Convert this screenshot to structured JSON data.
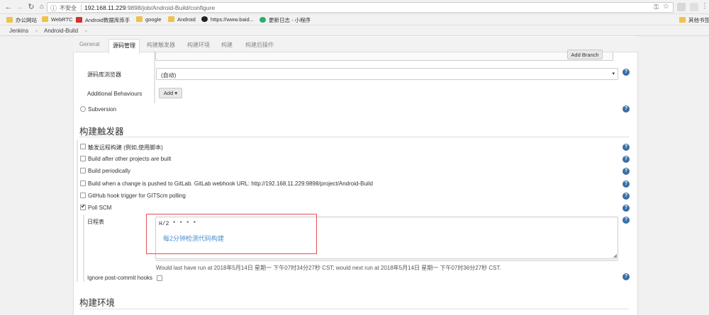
{
  "browser": {
    "insecure_label": "不安全",
    "url_host": "192.168.11.229",
    "url_rest": ":9898/job/Android-Build/configure"
  },
  "bookmarks": {
    "items": [
      {
        "label": "办公网站"
      },
      {
        "label": "WebRTC"
      },
      {
        "label": "Android数据库库手"
      },
      {
        "label": "google"
      },
      {
        "label": "Android"
      },
      {
        "label": "https://www.baid..."
      },
      {
        "label": "更新日志 - 小程序"
      }
    ],
    "other": "其他书签"
  },
  "breadcrumb": {
    "items": [
      "Jenkins",
      "›",
      "Android-Build",
      "›"
    ]
  },
  "tabs": [
    {
      "label": "General"
    },
    {
      "label": "源码管理"
    },
    {
      "label": "构建触发器"
    },
    {
      "label": "构建环境"
    },
    {
      "label": "构建"
    },
    {
      "label": "构建后操作"
    }
  ],
  "scm": {
    "add_branch": "Add Branch",
    "browser_label": "源码库浏览器",
    "browser_value": "(自动)",
    "behaviours_label": "Additional Behaviours",
    "add_label": "Add",
    "subversion": "Subversion"
  },
  "triggers": {
    "title": "构建触发器",
    "options": [
      {
        "label": "触发远程构建 (例如,使用脚本)",
        "checked": false
      },
      {
        "label": "Build after other projects are built",
        "checked": false
      },
      {
        "label": "Build periodically",
        "checked": false
      },
      {
        "label": "Build when a change is pushed to GitLab. GitLab webhook URL: http://192.168.11.229:9898/project/Android-Build",
        "checked": false
      },
      {
        "label": "GitHub hook trigger for GITScm polling",
        "checked": false
      },
      {
        "label": "Poll SCM",
        "checked": true
      }
    ],
    "schedule_label": "日程表",
    "schedule_value": "H/2 * * * *",
    "annotation": "每2分钟检测代码构建",
    "schedule_info": "Would last have run at 2018年5月14日 星期一 下午07时34分27秒 CST; would next run at 2018年5月14日 星期一 下午07时36分27秒 CST.",
    "ignore_label": "Ignore post-commit hooks"
  },
  "env": {
    "title": "构建环境"
  },
  "colors": {
    "help": "#3a6ea5",
    "annotation": "#e05050",
    "annotation_text": "#4a8fcf"
  }
}
